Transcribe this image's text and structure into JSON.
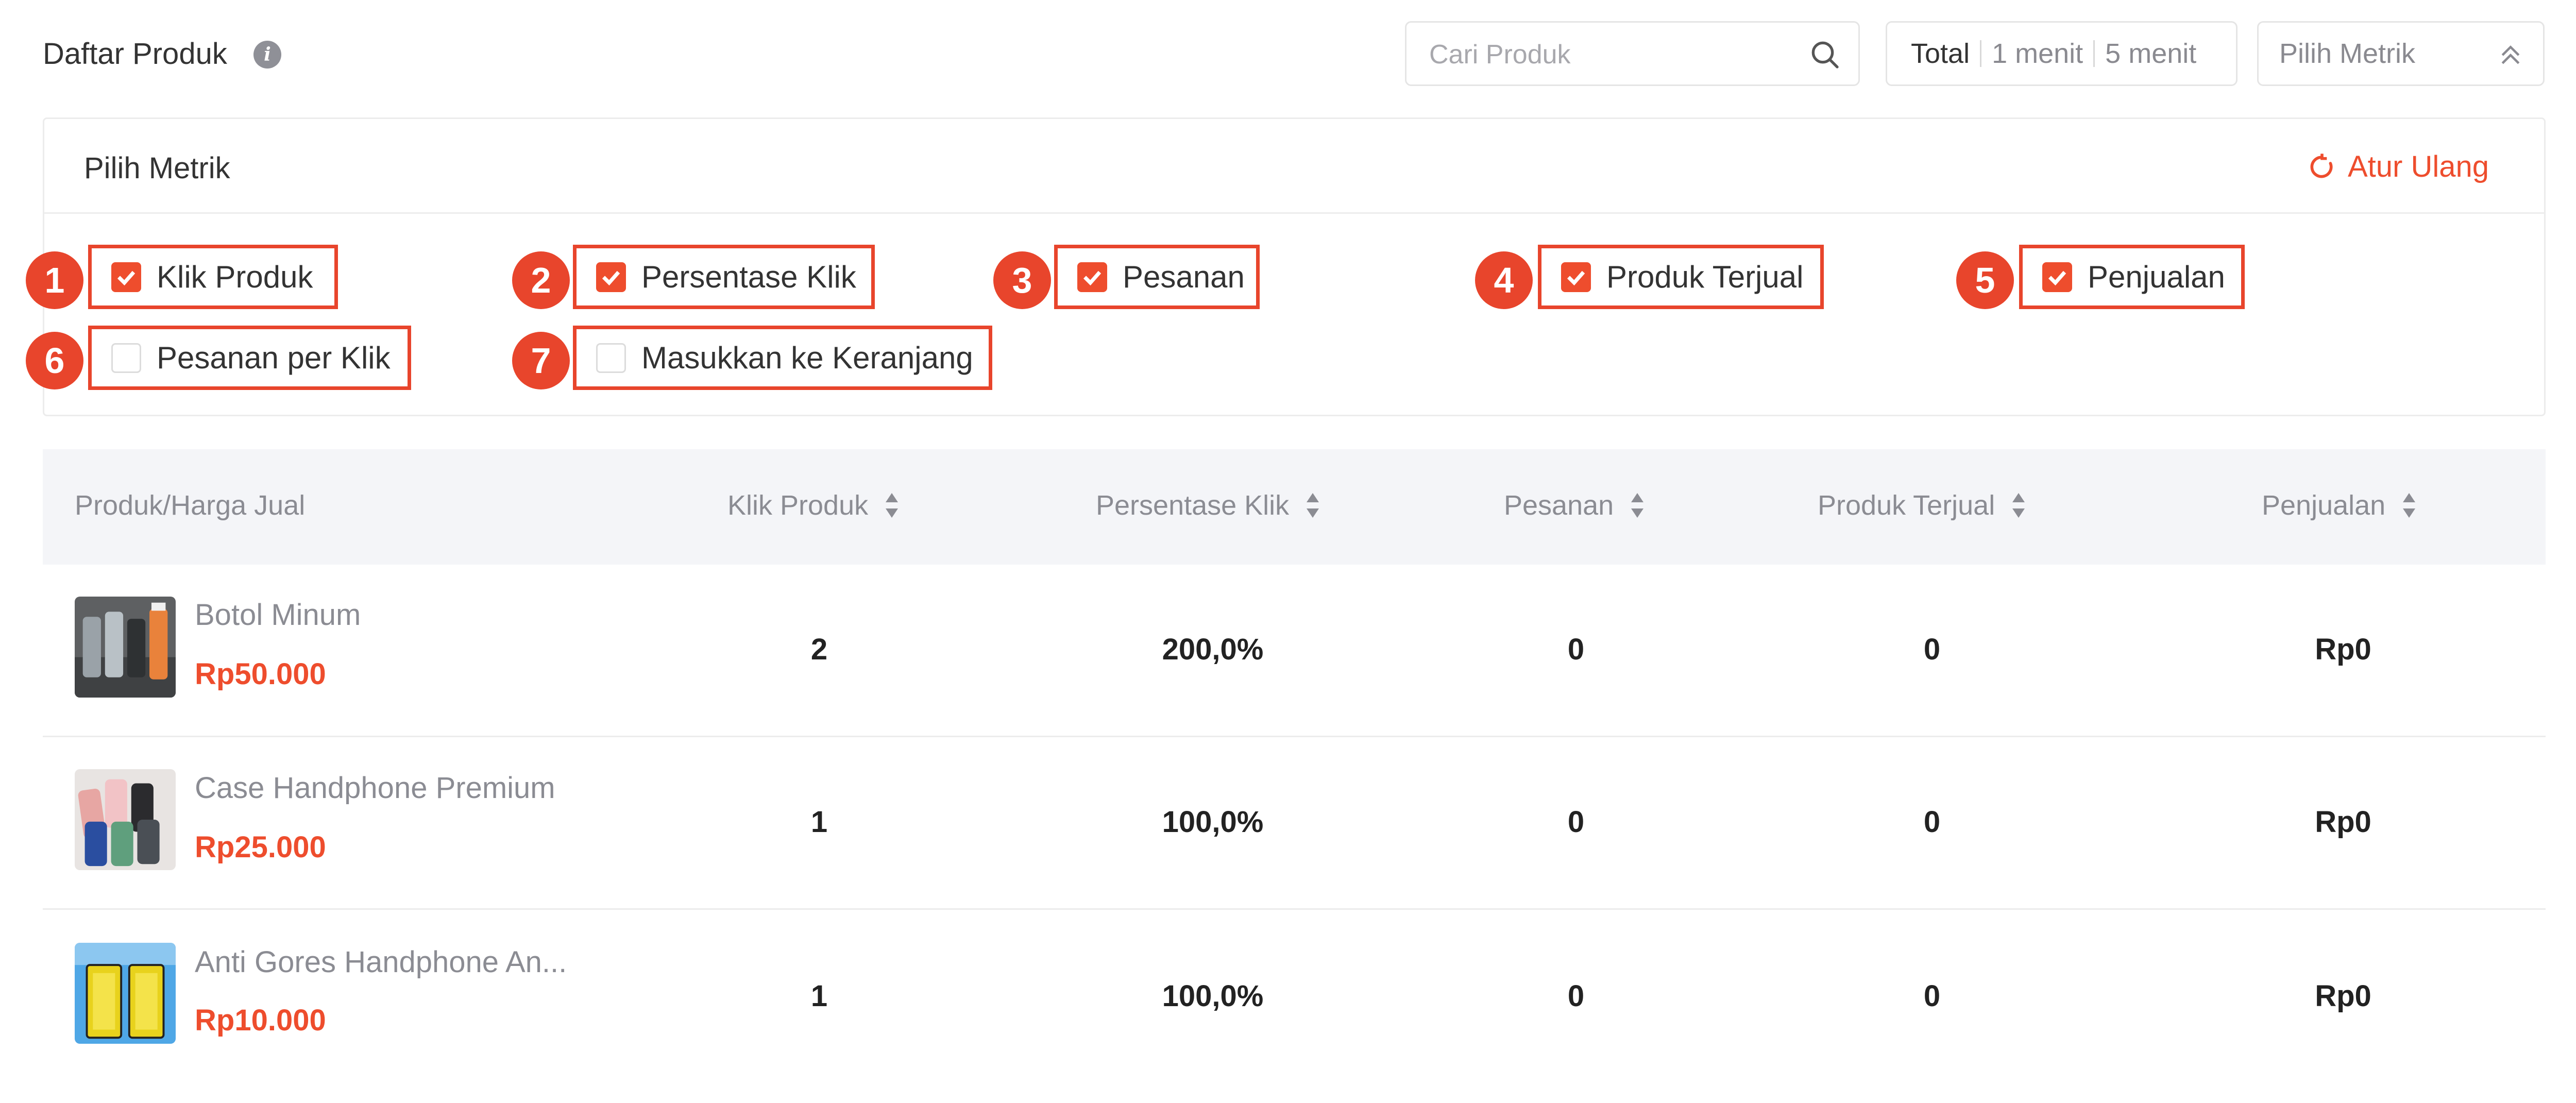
{
  "header": {
    "title": "Daftar Produk",
    "info_icon": "info-icon",
    "search": {
      "placeholder": "Cari Produk",
      "value": "",
      "icon": "search-icon"
    },
    "time_segments": [
      "Total",
      "1 menit",
      "5 menit"
    ],
    "metric_dropdown": {
      "label": "Pilih Metrik",
      "icon": "chevron-double-up-icon"
    }
  },
  "metric_panel": {
    "title": "Pilih Metrik",
    "reset_label": "Atur Ulang",
    "reset_icon": "refresh-icon",
    "accent": "#ee4d2d",
    "options": [
      {
        "badge": "1",
        "label": "Klik Produk",
        "checked": true
      },
      {
        "badge": "2",
        "label": "Persentase Klik",
        "checked": true
      },
      {
        "badge": "3",
        "label": "Pesanan",
        "checked": true
      },
      {
        "badge": "4",
        "label": "Produk Terjual",
        "checked": true
      },
      {
        "badge": "5",
        "label": "Penjualan",
        "checked": true
      },
      {
        "badge": "6",
        "label": "Pesanan per Klik",
        "checked": false
      },
      {
        "badge": "7",
        "label": "Masukkan ke Keranjang",
        "checked": false
      }
    ]
  },
  "table": {
    "columns": [
      "Produk/Harga Jual",
      "Klik Produk",
      "Persentase Klik",
      "Pesanan",
      "Produk Terjual",
      "Penjualan"
    ],
    "rows": [
      {
        "name": "Botol Minum",
        "price": "Rp50.000",
        "klik": "2",
        "persentase": "200,0%",
        "pesanan": "0",
        "terjual": "0",
        "penjualan": "Rp0"
      },
      {
        "name": "Case Handphone Premium",
        "price": "Rp25.000",
        "klik": "1",
        "persentase": "100,0%",
        "pesanan": "0",
        "terjual": "0",
        "penjualan": "Rp0"
      },
      {
        "name": "Anti Gores Handphone An...",
        "price": "Rp10.000",
        "klik": "1",
        "persentase": "100,0%",
        "pesanan": "0",
        "terjual": "0",
        "penjualan": "Rp0"
      }
    ]
  }
}
